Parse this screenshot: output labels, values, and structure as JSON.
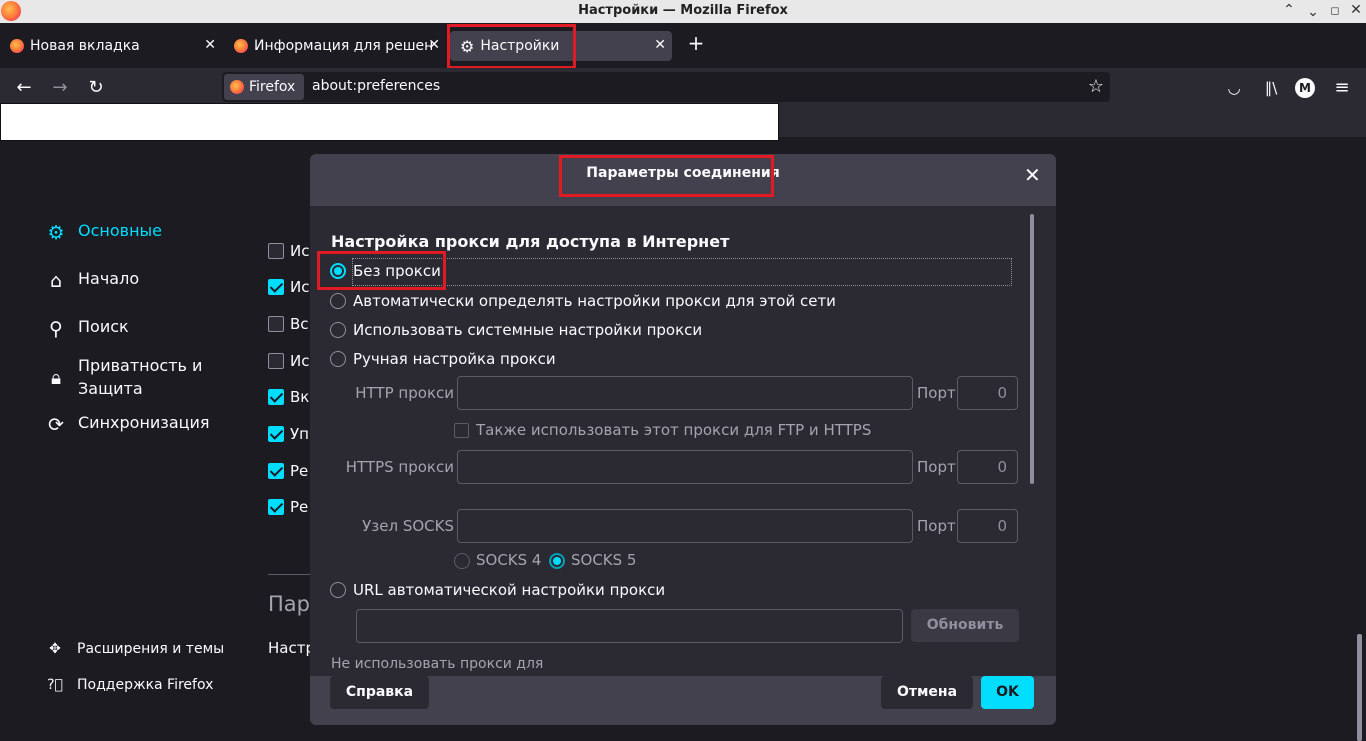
{
  "window": {
    "title": "Настройки — Mozilla Firefox"
  },
  "tabs": [
    {
      "label": "Новая вкладка"
    },
    {
      "label": "Информация для решения проблем"
    },
    {
      "label": "Настройки"
    }
  ],
  "navbar": {
    "identity_label": "Firefox",
    "url": "about:preferences"
  },
  "sidebar": {
    "items": [
      {
        "label": "Основные"
      },
      {
        "label": "Начало"
      },
      {
        "label": "Поиск"
      },
      {
        "label": "Приватность и\nЗащита"
      },
      {
        "label": "Синхронизация"
      }
    ],
    "footer": [
      {
        "label": "Расширения и темы"
      },
      {
        "label": "Поддержка Firefox"
      }
    ]
  },
  "background": {
    "check_labels": [
      "Ис",
      "Ис",
      "Вс",
      "Ис",
      "Вк",
      "Уп",
      "Ре",
      "Ре"
    ],
    "section_heading": "Пар",
    "section_text": "Настр"
  },
  "dialog": {
    "title": "Параметры соединения",
    "section_title": "Настройка прокси для доступа в Интернет",
    "options": {
      "no_proxy": "Без прокси",
      "auto_detect": "Автоматически определять настройки прокси для этой сети",
      "system": "Использовать системные настройки прокси",
      "manual": "Ручная настройка прокси"
    },
    "http_label": "HTTP прокси",
    "https_label": "HTTPS прокси",
    "socks_label": "Узел SOCKS",
    "port_label": "Порт",
    "http_port": "0",
    "https_port": "0",
    "socks_port": "0",
    "also_use_label": "Также использовать этот прокси для FTP и HTTPS",
    "socks4": "SOCKS 4",
    "socks5": "SOCKS 5",
    "auto_url_label": "URL автоматической настройки прокси",
    "reload_button": "Обновить",
    "no_proxy_for": "Не использовать прокси для",
    "help_button": "Справка",
    "cancel_button": "Отмена",
    "ok_button": "OK"
  }
}
